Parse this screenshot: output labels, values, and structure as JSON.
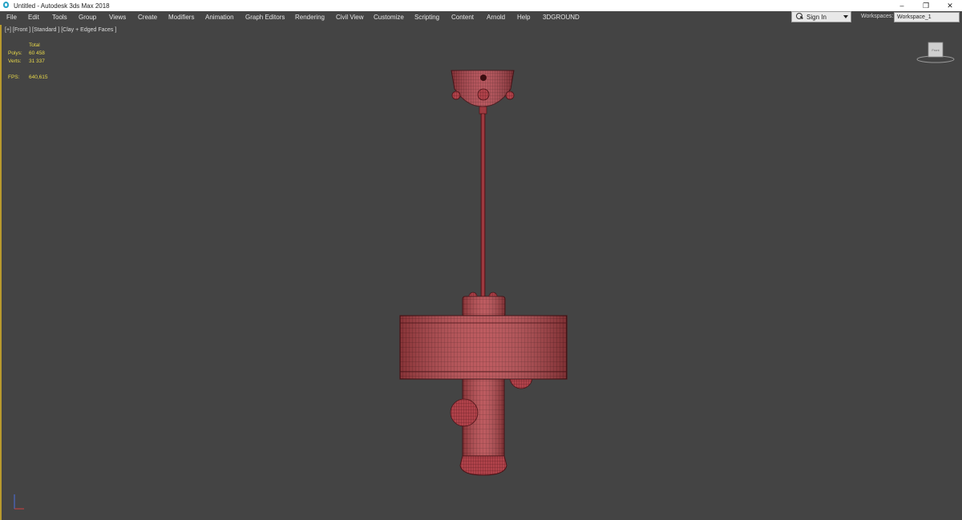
{
  "window": {
    "title": "Untitled - Autodesk 3ds Max 2018",
    "icon": "3ds-max-app-icon",
    "controls": {
      "minimize": "–",
      "restore": "❐",
      "close": "✕"
    }
  },
  "menubar": {
    "items": [
      "File",
      "Edit",
      "Tools",
      "Group",
      "Views",
      "Create",
      "Modifiers",
      "Animation",
      "Graph Editors",
      "Rendering",
      "Civil View",
      "Customize",
      "Scripting",
      "Content",
      "Arnold",
      "Help",
      "3DGROUND"
    ],
    "signin_label": "Sign In",
    "workspaces_label": "Workspaces:",
    "workspace_value": "Workspace_1"
  },
  "viewport": {
    "label": "[+] [Front ] [Standard ] [Clay + Edged Faces ]",
    "stats": {
      "total_label": "Total",
      "polys_label": "Polys:",
      "polys_value": "60 458",
      "verts_label": "Verts:",
      "verts_value": "31 337",
      "fps_label": "FPS:",
      "fps_value": "640,615"
    },
    "viewcube_face": "Front",
    "model_color": "#b5454a",
    "wire_color": "#5a1a1e",
    "accent_border": "#b89a2e"
  }
}
